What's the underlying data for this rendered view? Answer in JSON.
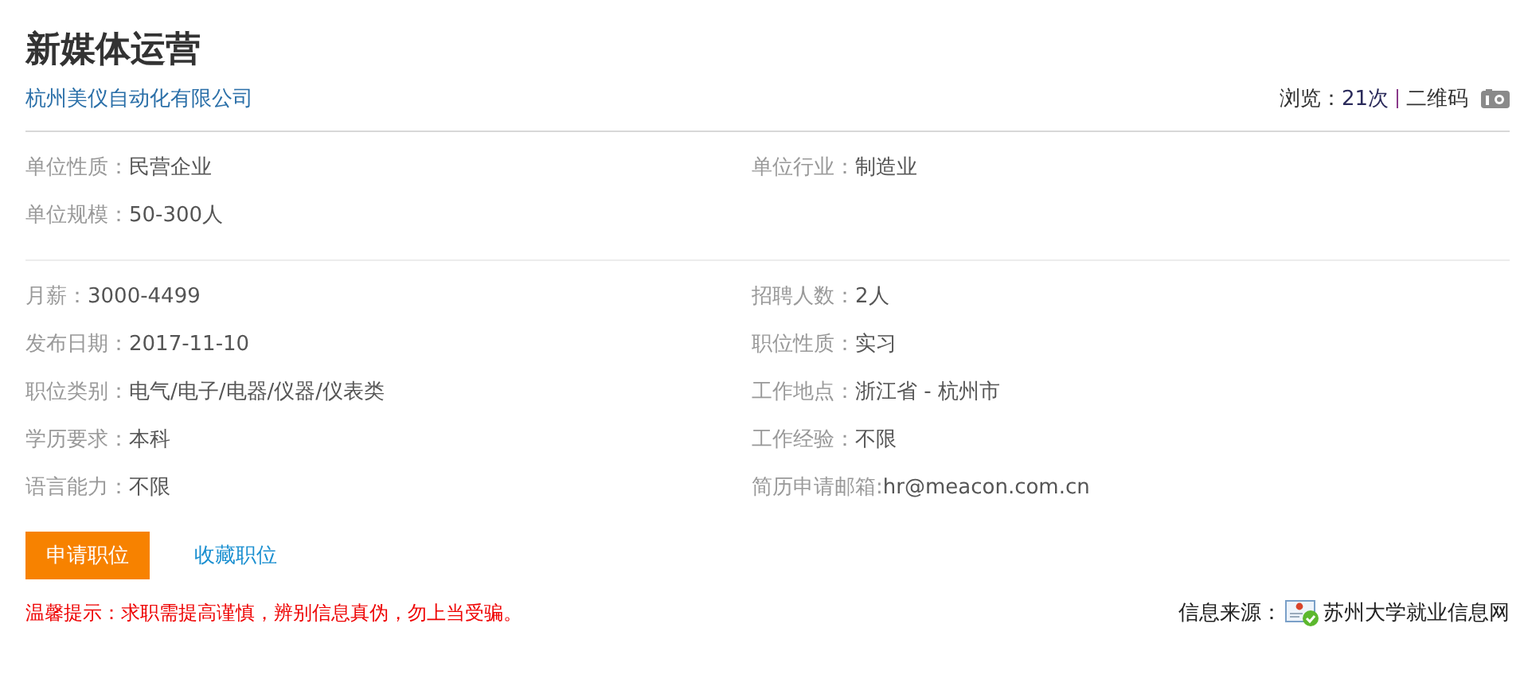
{
  "title": "新媒体运营",
  "company": "杭州美仪自动化有限公司",
  "stats": {
    "views_label": "浏览：",
    "views_value": "21次",
    "qr_label": "二维码"
  },
  "unit_info": [
    {
      "label": "单位性质：",
      "value": "民营企业"
    },
    {
      "label": "单位行业：",
      "value": "制造业"
    },
    {
      "label": "单位规模：",
      "value": "50-300人"
    }
  ],
  "job_info": [
    {
      "label": "月薪：",
      "value": "3000-4499"
    },
    {
      "label": "招聘人数：",
      "value": "2人"
    },
    {
      "label": "发布日期：",
      "value": "2017-11-10"
    },
    {
      "label": "职位性质：",
      "value": "实习"
    },
    {
      "label": "职位类别：",
      "value": "电气/电子/电器/仪器/仪表类"
    },
    {
      "label": "工作地点：",
      "value": "浙江省 - 杭州市"
    },
    {
      "label": "学历要求：",
      "value": "本科"
    },
    {
      "label": "工作经验：",
      "value": "不限"
    },
    {
      "label": "语言能力：",
      "value": "不限"
    },
    {
      "label": "简历申请邮箱:",
      "value": "hr@meacon.com.cn"
    }
  ],
  "actions": [
    {
      "kind": "primary",
      "label": "申请职位"
    },
    {
      "kind": "link",
      "label": "收藏职位"
    }
  ],
  "tip": "温馨提示：求职需提高谨慎，辨别信息真伪，勿上当受骗。",
  "source": {
    "label": "信息来源：",
    "name": "苏州大学就业信息网"
  }
}
